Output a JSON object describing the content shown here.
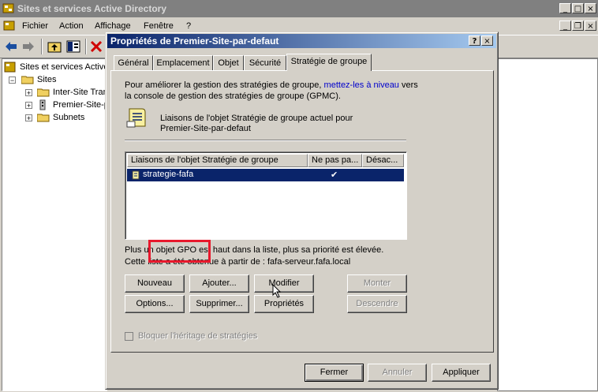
{
  "main_window": {
    "title": "Sites et services Active Directory",
    "caption_buttons": {
      "minimize": "_",
      "maximize": "□",
      "close": "×"
    },
    "menu": [
      "Fichier",
      "Action",
      "Affichage",
      "Fenêtre",
      "?"
    ],
    "child_buttons": {
      "minimize": "_",
      "restore": "❐",
      "close": "×"
    }
  },
  "tree": {
    "root": "Sites et services Active Directory",
    "sites": "Sites",
    "children": [
      "Inter-Site Transports",
      "Premier-Site-par-defaut",
      "Subnets"
    ]
  },
  "dialog": {
    "title": "Propriétés de Premier-Site-par-defaut",
    "help_button": "?",
    "close_button": "×",
    "tabs": [
      "Général",
      "Emplacement",
      "Objet",
      "Sécurité",
      "Stratégie de groupe"
    ],
    "active_tab": "Stratégie de groupe",
    "intro_line1_pre": "Pour améliorer la gestion des stratégies de groupe, ",
    "intro_link": "mettez-les à niveau",
    "intro_line1_post": " vers",
    "intro_line2": "la console de gestion des stratégies de groupe (GPMC).",
    "current_links_line1": "Liaisons de l'objet Stratégie de groupe actuel pour",
    "current_links_line2": "Premier-Site-par-defaut",
    "list": {
      "columns": [
        "Liaisons de l'objet Stratégie de groupe",
        "Ne pas pa...",
        "Désac..."
      ],
      "rows": [
        {
          "name": "strategie-fafa",
          "no_override": "✔",
          "disabled": ""
        }
      ]
    },
    "priority_note": "Plus un objet GPO est haut dans la liste, plus sa priorité est élevée.",
    "source_note": "Cette liste a été obtenue à partir de : fafa-serveur.fafa.local",
    "buttons": {
      "new": "Nouveau",
      "add": "Ajouter...",
      "edit": "Modifier",
      "up": "Monter",
      "options": "Options...",
      "delete": "Supprimer...",
      "properties": "Propriétés",
      "down": "Descendre"
    },
    "block_inheritance": "Bloquer l'héritage de stratégies",
    "footer": {
      "ok": "Fermer",
      "cancel": "Annuler",
      "apply": "Appliquer"
    }
  },
  "colors": {
    "highlight": "#e8182c",
    "title_active": "#0a246a",
    "title_inactive": "#808080"
  }
}
